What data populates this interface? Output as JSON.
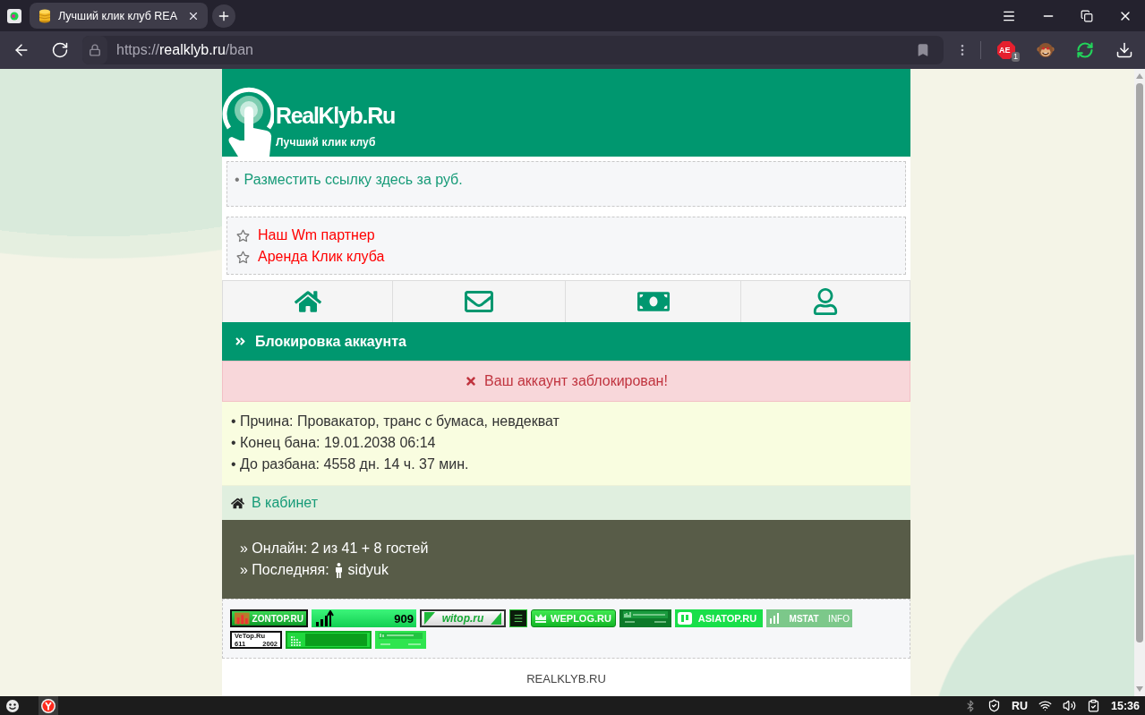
{
  "browser": {
    "tab": {
      "title": "Лучший клик клуб REA",
      "selected": true
    },
    "address": {
      "scheme": "https://",
      "host": "realklyb.ru",
      "path": "/ban"
    },
    "extension": {
      "label": "AE",
      "badge": "1"
    }
  },
  "header": {
    "logo_title": "RealKlyb.Ru",
    "logo_subtitle": "Лучший клик клуб"
  },
  "promo": {
    "bullet": "•",
    "text": "Разместить ссылку здесь за руб."
  },
  "partner_links": [
    "Наш Wm партнер",
    "Аренда Клик клуба"
  ],
  "section": {
    "title": "Блокировка аккаунта"
  },
  "alert": {
    "kind": "error",
    "text": "Ваш аккаунт заблокирован!"
  },
  "ban_details": [
    "• Прчина: Провакатор, транс с бумаса, невдекват",
    "• Конец бана: 19.01.2038 06:14",
    "• До разбана: 4558 дн. 14 ч. 37 мин."
  ],
  "cabinet_link": "В кабинет",
  "stats": {
    "online": "» Онлайн: 2 из 41 + 8 гостей",
    "last_label": "» Последняя:",
    "last_user": "sidyuk"
  },
  "counters": [
    {
      "kind": "zontop",
      "label": "ZONTOP.RU"
    },
    {
      "kind": "bars",
      "label": "909"
    },
    {
      "kind": "witop",
      "label": "witop.ru"
    },
    {
      "kind": "square"
    },
    {
      "kind": "weplog",
      "label": "WEPLOG.RU"
    },
    {
      "kind": "graph"
    },
    {
      "kind": "asiatop",
      "label": "ASIATOP.RU"
    },
    {
      "kind": "mstat",
      "label": "MSTAT",
      "value": "INFO"
    },
    {
      "kind": "vetop",
      "label": "VeTop.Ru",
      "values": [
        "611",
        "2002"
      ]
    },
    {
      "kind": "greenbar"
    },
    {
      "kind": "graph_small"
    }
  ],
  "footer": {
    "site": "REALKLYB.RU"
  },
  "taskbar": {
    "language": "RU",
    "time": "15:36"
  }
}
